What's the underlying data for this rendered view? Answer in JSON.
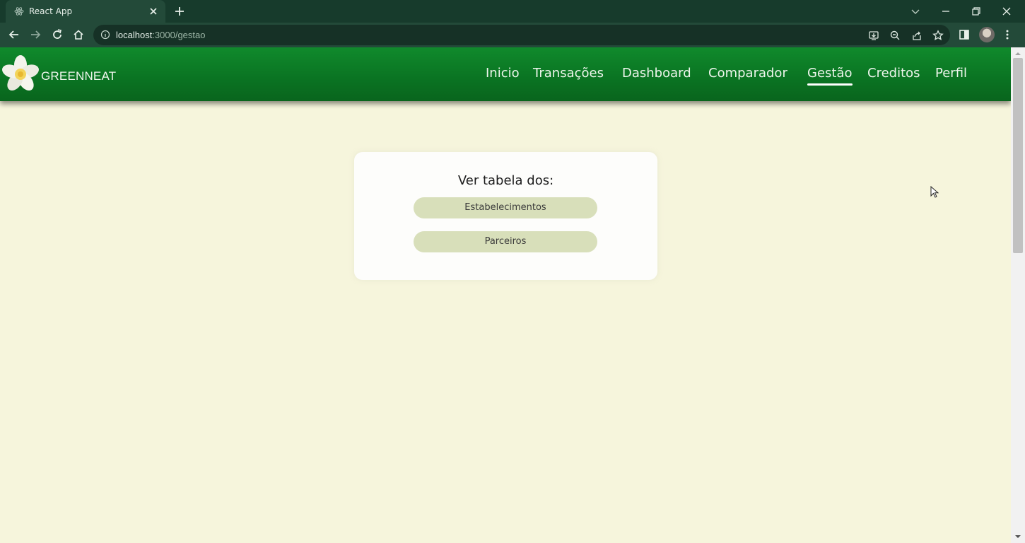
{
  "browser": {
    "tab_title": "React App",
    "url_host": "localhost",
    "url_path": ":3000/gestao"
  },
  "app": {
    "brand": "GREENNEAT",
    "nav": [
      {
        "label": "Inicio"
      },
      {
        "label": "Transações"
      },
      {
        "label": "Dashboard"
      },
      {
        "label": "Comparador"
      },
      {
        "label": "Gestão"
      },
      {
        "label": "Creditos"
      },
      {
        "label": "Perfil"
      }
    ],
    "active_nav": "Gestão",
    "colors": {
      "nav_green": "#0a7322",
      "page_bg": "#f6f5dc",
      "button_bg": "#d8dfba"
    }
  },
  "card": {
    "title": "Ver tabela dos:",
    "buttons": [
      {
        "label": "Estabelecimentos"
      },
      {
        "label": "Parceiros"
      }
    ]
  },
  "icons": [
    "react-favicon-icon",
    "close-icon",
    "plus-icon",
    "back-icon",
    "forward-icon",
    "reload-icon",
    "home-icon",
    "info-icon",
    "install-icon",
    "zoom-icon",
    "share-icon",
    "star-icon",
    "sidepanel-icon",
    "menu-icon",
    "flower-logo-icon"
  ]
}
